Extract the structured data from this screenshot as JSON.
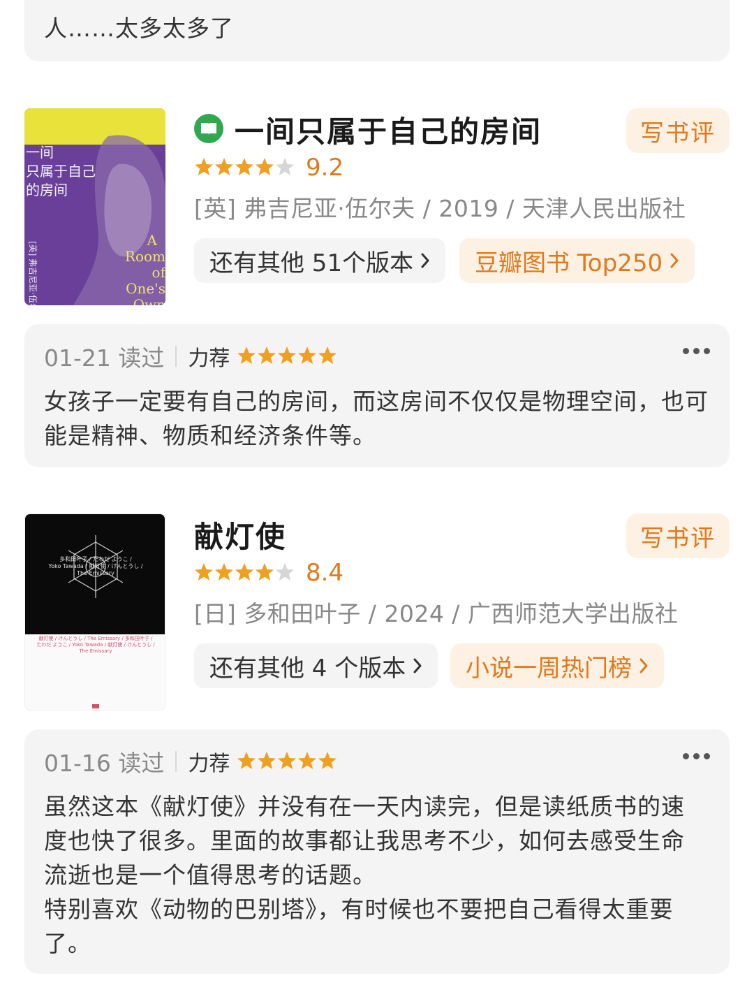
{
  "top_review": {
    "text": "人……太多太多了"
  },
  "books": [
    {
      "title": "一间只属于自己的房间",
      "ebook_icon": "book-icon",
      "rating": "9.2",
      "stars": 4.5,
      "meta": "[英] 弗吉尼亚·伍尔夫 / 2019 / 天津人民出版社",
      "write_review": "写书评",
      "editions": "还有其他 51个版本",
      "rank": "豆瓣图书 Top250",
      "cover": {
        "title_lines": [
          "一间",
          "只属于自己",
          "的房间"
        ],
        "en_lines": [
          "A",
          "Room",
          "of",
          "One's",
          "Own"
        ],
        "side_text": "[英] 弗吉尼亚·伍尔夫",
        "bg_top": "#e8e23a",
        "bg_main": "#6a3f9a"
      },
      "review": {
        "date": "01-21 读过",
        "rec": "力荐",
        "stars": 5,
        "text": "女孩子一定要有自己的房间，而这房间不仅仅是物理空间，也可能是精神、物质和经济条件等。"
      }
    },
    {
      "title": "献灯使",
      "rating": "8.4",
      "stars": 4,
      "meta": "[日] 多和田叶子 / 2024 / 广西师范大学出版社",
      "write_review": "写书评",
      "editions": "还有其他 4 个版本",
      "rank": "小说一周热门榜",
      "cover": {
        "line1": "多和田叶子 / たわだ ようこ /",
        "line2": "Yoko Tawada / 献灯使 / けんとうし /",
        "line3": "The Emissary",
        "line4": "献灯使 / けんとうし / The Emissary / 多和田叶子 /",
        "line5": "たわだ ようこ / Yoko Tawada / 献灯使 / けんとうし /",
        "line6": "The Emissary"
      },
      "review": {
        "date": "01-16 读过",
        "rec": "力荐",
        "stars": 5,
        "text_lines": [
          "虽然这本《献灯使》并没有在一天内读完，但是读纸质书的速",
          "度也快了很多。里面的故事都让我思考不少，如何去感受生命",
          "流逝也是一个值得思考的话题。",
          "特别喜欢《动物的巴别塔》，有时候也不要把自己看得太重要",
          "了。"
        ]
      }
    }
  ],
  "colors": {
    "accent": "#e0791c",
    "star": "#f0a020",
    "star_empty": "#d6d6d6",
    "ebook_green": "#2fa84f"
  }
}
